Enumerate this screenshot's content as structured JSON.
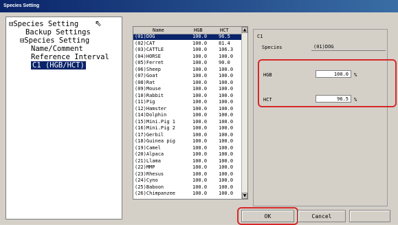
{
  "window": {
    "title": "Species Setting"
  },
  "tree": {
    "items": [
      "⊟Species Setting",
      "Backup Settings",
      "⊟Species Setting",
      "Name/Comment",
      "Reference Interval",
      "C1 (HGB/HCT)"
    ]
  },
  "species_list": {
    "headers": [
      "Name",
      "HGB",
      "HCT"
    ],
    "rows": [
      {
        "name": "(01)DOG",
        "hgb": "100.0",
        "hct": "96.5"
      },
      {
        "name": "(02)CAT",
        "hgb": "100.0",
        "hct": "81.4"
      },
      {
        "name": "(03)CATTLE",
        "hgb": "100.0",
        "hct": "106.3"
      },
      {
        "name": "(04)HORSE",
        "hgb": "100.0",
        "hct": "100.0"
      },
      {
        "name": "(05)Ferret",
        "hgb": "100.0",
        "hct": "90.0"
      },
      {
        "name": "(06)Sheep",
        "hgb": "100.0",
        "hct": "100.0"
      },
      {
        "name": "(07)Goat",
        "hgb": "100.0",
        "hct": "100.0"
      },
      {
        "name": "(08)Rat",
        "hgb": "100.0",
        "hct": "100.0"
      },
      {
        "name": "(09)Mouse",
        "hgb": "100.0",
        "hct": "100.0"
      },
      {
        "name": "(10)Rabbit",
        "hgb": "100.0",
        "hct": "100.0"
      },
      {
        "name": "(11)Pig",
        "hgb": "100.0",
        "hct": "100.0"
      },
      {
        "name": "(12)Hamster",
        "hgb": "100.0",
        "hct": "100.0"
      },
      {
        "name": "(14)Dolphin",
        "hgb": "100.0",
        "hct": "100.0"
      },
      {
        "name": "(15)Mini.Pig 1",
        "hgb": "100.0",
        "hct": "100.0"
      },
      {
        "name": "(16)Mini.Pig 2",
        "hgb": "100.0",
        "hct": "100.0"
      },
      {
        "name": "(17)Gerbil",
        "hgb": "100.0",
        "hct": "100.0"
      },
      {
        "name": "(18)Guinea pig",
        "hgb": "100.0",
        "hct": "100.0"
      },
      {
        "name": "(19)Camel",
        "hgb": "100.0",
        "hct": "100.0"
      },
      {
        "name": "(20)Alpaca",
        "hgb": "100.0",
        "hct": "100.0"
      },
      {
        "name": "(21)Llama",
        "hgb": "100.0",
        "hct": "100.0"
      },
      {
        "name": "(22)MMP",
        "hgb": "100.0",
        "hct": "100.0"
      },
      {
        "name": "(23)Rhesus",
        "hgb": "100.0",
        "hct": "100.0"
      },
      {
        "name": "(24)Cyno",
        "hgb": "100.0",
        "hct": "100.0"
      },
      {
        "name": "(25)Baboon",
        "hgb": "100.0",
        "hct": "100.0"
      },
      {
        "name": "(26)Chimpanzee",
        "hgb": "100.0",
        "hct": "100.0"
      }
    ],
    "selected_index": 0,
    "scroll_up": "▲",
    "scroll_down": "▼"
  },
  "panel": {
    "group_title": "C1",
    "species_label": "Species",
    "species_value": "(01)DOG",
    "hgb_label": "HGB",
    "hgb_value": "100.0",
    "hgb_unit": "%",
    "hct_label": "HCT",
    "hct_value": "96.5",
    "hct_unit": "%"
  },
  "buttons": {
    "ok": "OK",
    "cancel": "Cancel"
  },
  "colors": {
    "highlight_outline": "#d62828",
    "selection": "#0a246a"
  }
}
